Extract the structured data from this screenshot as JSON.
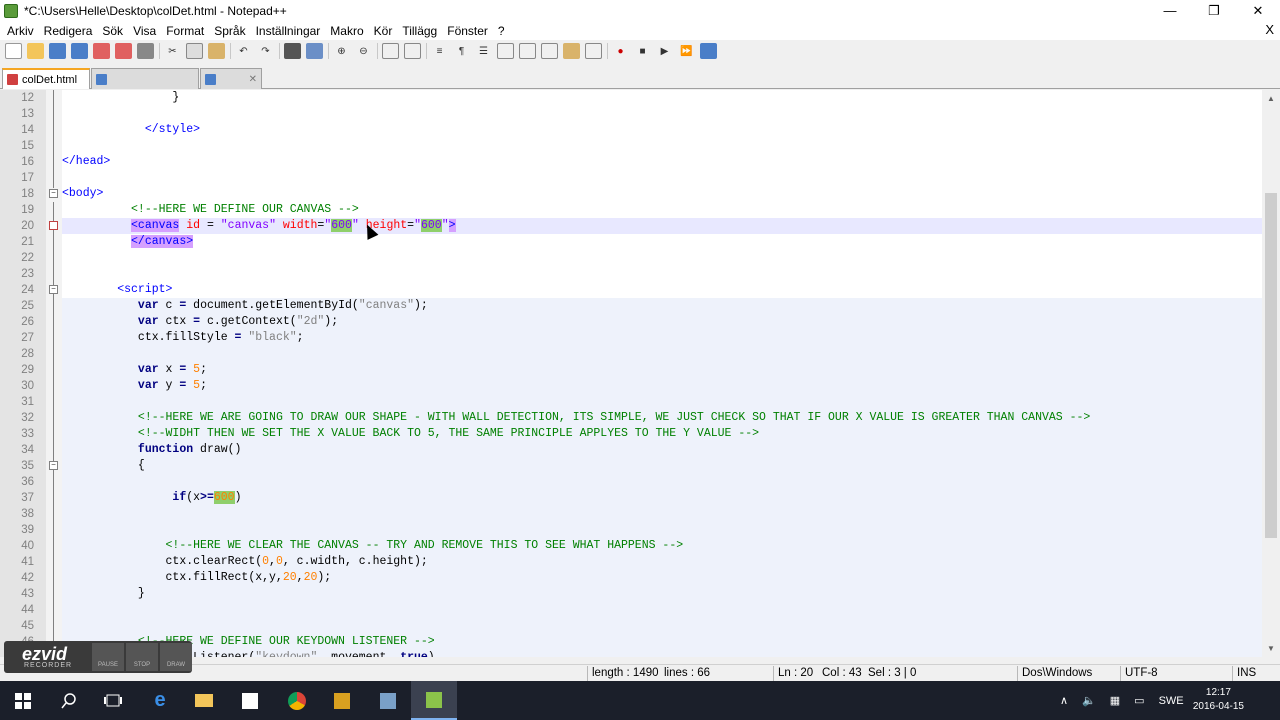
{
  "window": {
    "title": "*C:\\Users\\Helle\\Desktop\\colDet.html - Notepad++",
    "minimize": "—",
    "restore": "❐",
    "close": "✕"
  },
  "menu": {
    "items": [
      "Arkiv",
      "Redigera",
      "Sök",
      "Visa",
      "Format",
      "Språk",
      "Inställningar",
      "Makro",
      "Kör",
      "Tillägg",
      "Fönster",
      "?"
    ],
    "close_doc": "X"
  },
  "tabs": [
    {
      "label": "colDet.html",
      "active": true
    },
    {
      "label": "",
      "active": false
    },
    {
      "label": "",
      "active": false
    }
  ],
  "editor": {
    "lines": [
      {
        "n": "12",
        "tokens": [
          {
            "t": "                }",
            "c": "t-plain"
          }
        ]
      },
      {
        "n": "13",
        "tokens": []
      },
      {
        "n": "14",
        "tokens": [
          {
            "t": "            ",
            "c": "t-plain"
          },
          {
            "t": "</style>",
            "c": "t-tag"
          }
        ]
      },
      {
        "n": "15",
        "tokens": []
      },
      {
        "n": "16",
        "tokens": [
          {
            "t": "</head>",
            "c": "t-tag"
          }
        ]
      },
      {
        "n": "17",
        "tokens": []
      },
      {
        "n": "18",
        "tokens": [
          {
            "t": "<body>",
            "c": "t-tag"
          }
        ]
      },
      {
        "n": "19",
        "tokens": [
          {
            "t": "          ",
            "c": "t-plain"
          },
          {
            "t": "<!--HERE WE DEFINE OUR CANVAS -->",
            "c": "t-cmt"
          }
        ]
      },
      {
        "n": "20",
        "tokens": [
          {
            "t": "          ",
            "c": "t-plain"
          },
          {
            "t": "<canvas",
            "c": "t-tag hl-tag"
          },
          {
            "t": " ",
            "c": "t-plain"
          },
          {
            "t": "id",
            "c": "t-attr"
          },
          {
            "t": " = ",
            "c": "t-plain"
          },
          {
            "t": "\"canvas\"",
            "c": "t-val"
          },
          {
            "t": " ",
            "c": "t-plain"
          },
          {
            "t": "width",
            "c": "t-attr"
          },
          {
            "t": "=",
            "c": "t-plain"
          },
          {
            "t": "\"",
            "c": "t-val"
          },
          {
            "t": "600",
            "c": "t-val hl-green"
          },
          {
            "t": "\"",
            "c": "t-val"
          },
          {
            "t": " ",
            "c": "t-plain"
          },
          {
            "t": "height",
            "c": "t-attr"
          },
          {
            "t": "=",
            "c": "t-plain"
          },
          {
            "t": "\"",
            "c": "t-val"
          },
          {
            "t": "600",
            "c": "t-val hl-green"
          },
          {
            "t": "\"",
            "c": "t-val"
          },
          {
            "t": ">",
            "c": "t-tag hl-tag"
          }
        ]
      },
      {
        "n": "21",
        "tokens": [
          {
            "t": "          ",
            "c": "t-plain"
          },
          {
            "t": "</canvas>",
            "c": "t-tag hl-tag"
          }
        ]
      },
      {
        "n": "22",
        "tokens": []
      },
      {
        "n": "23",
        "tokens": []
      },
      {
        "n": "24",
        "tokens": [
          {
            "t": "        ",
            "c": "t-plain"
          },
          {
            "t": "<script>",
            "c": "t-tag"
          }
        ]
      },
      {
        "n": "25",
        "tokens": [
          {
            "t": "           ",
            "c": "t-plain"
          },
          {
            "t": "var",
            "c": "t-kw"
          },
          {
            "t": " c ",
            "c": "t-plain"
          },
          {
            "t": "=",
            "c": "t-op"
          },
          {
            "t": " document.getElementById(",
            "c": "t-plain"
          },
          {
            "t": "\"canvas\"",
            "c": "t-str"
          },
          {
            "t": ");",
            "c": "t-plain"
          }
        ]
      },
      {
        "n": "26",
        "tokens": [
          {
            "t": "           ",
            "c": "t-plain"
          },
          {
            "t": "var",
            "c": "t-kw"
          },
          {
            "t": " ctx ",
            "c": "t-plain"
          },
          {
            "t": "=",
            "c": "t-op"
          },
          {
            "t": " c.getContext(",
            "c": "t-plain"
          },
          {
            "t": "\"2d\"",
            "c": "t-str"
          },
          {
            "t": ");",
            "c": "t-plain"
          }
        ]
      },
      {
        "n": "27",
        "tokens": [
          {
            "t": "           ctx.fillStyle ",
            "c": "t-plain"
          },
          {
            "t": "=",
            "c": "t-op"
          },
          {
            "t": " ",
            "c": "t-plain"
          },
          {
            "t": "\"black\"",
            "c": "t-str"
          },
          {
            "t": ";",
            "c": "t-plain"
          }
        ]
      },
      {
        "n": "28",
        "tokens": []
      },
      {
        "n": "29",
        "tokens": [
          {
            "t": "           ",
            "c": "t-plain"
          },
          {
            "t": "var",
            "c": "t-kw"
          },
          {
            "t": " x ",
            "c": "t-plain"
          },
          {
            "t": "=",
            "c": "t-op"
          },
          {
            "t": " ",
            "c": "t-plain"
          },
          {
            "t": "5",
            "c": "t-num"
          },
          {
            "t": ";",
            "c": "t-plain"
          }
        ]
      },
      {
        "n": "30",
        "tokens": [
          {
            "t": "           ",
            "c": "t-plain"
          },
          {
            "t": "var",
            "c": "t-kw"
          },
          {
            "t": " y ",
            "c": "t-plain"
          },
          {
            "t": "=",
            "c": "t-op"
          },
          {
            "t": " ",
            "c": "t-plain"
          },
          {
            "t": "5",
            "c": "t-num"
          },
          {
            "t": ";",
            "c": "t-plain"
          }
        ]
      },
      {
        "n": "31",
        "tokens": []
      },
      {
        "n": "32",
        "tokens": [
          {
            "t": "           ",
            "c": "t-plain"
          },
          {
            "t": "<!--HERE WE ARE GOING TO DRAW OUR SHAPE - WITH WALL DETECTION, ITS SIMPLE, WE JUST CHECK SO THAT IF OUR X VALUE IS GREATER THAN CANVAS -->",
            "c": "t-cmt"
          }
        ]
      },
      {
        "n": "33",
        "tokens": [
          {
            "t": "           ",
            "c": "t-plain"
          },
          {
            "t": "<!--WIDHT THEN WE SET THE X VALUE BACK TO 5, THE SAME PRINCIPLE APPLYES TO THE Y VALUE -->",
            "c": "t-cmt"
          }
        ]
      },
      {
        "n": "34",
        "tokens": [
          {
            "t": "           ",
            "c": "t-plain"
          },
          {
            "t": "function",
            "c": "t-kw"
          },
          {
            "t": " draw()",
            "c": "t-plain"
          }
        ]
      },
      {
        "n": "35",
        "tokens": [
          {
            "t": "           {",
            "c": "t-plain"
          }
        ]
      },
      {
        "n": "36",
        "tokens": []
      },
      {
        "n": "37",
        "tokens": [
          {
            "t": "                ",
            "c": "t-plain"
          },
          {
            "t": "if",
            "c": "t-kw"
          },
          {
            "t": "(x",
            "c": "t-plain"
          },
          {
            "t": ">=",
            "c": "t-op"
          },
          {
            "t": "600",
            "c": "t-num hl-green"
          },
          {
            "t": ")",
            "c": "t-plain"
          }
        ]
      },
      {
        "n": "38",
        "tokens": []
      },
      {
        "n": "39",
        "tokens": []
      },
      {
        "n": "40",
        "tokens": [
          {
            "t": "               ",
            "c": "t-plain"
          },
          {
            "t": "<!--HERE WE CLEAR THE CANVAS -- TRY AND REMOVE THIS TO SEE WHAT HAPPENS -->",
            "c": "t-cmt"
          }
        ]
      },
      {
        "n": "41",
        "tokens": [
          {
            "t": "               ctx.clearRect(",
            "c": "t-plain"
          },
          {
            "t": "0",
            "c": "t-num"
          },
          {
            "t": ",",
            "c": "t-plain"
          },
          {
            "t": "0",
            "c": "t-num"
          },
          {
            "t": ", c.width, c.height);",
            "c": "t-plain"
          }
        ]
      },
      {
        "n": "42",
        "tokens": [
          {
            "t": "               ctx.fillRect(x,y,",
            "c": "t-plain"
          },
          {
            "t": "20",
            "c": "t-num"
          },
          {
            "t": ",",
            "c": "t-plain"
          },
          {
            "t": "20",
            "c": "t-num"
          },
          {
            "t": ");",
            "c": "t-plain"
          }
        ]
      },
      {
        "n": "43",
        "tokens": [
          {
            "t": "           }",
            "c": "t-plain"
          }
        ]
      },
      {
        "n": "44",
        "tokens": []
      },
      {
        "n": "45",
        "tokens": []
      },
      {
        "n": "46",
        "tokens": [
          {
            "t": "           ",
            "c": "t-plain"
          },
          {
            "t": "<!--HERE WE DEFINE OUR KEYDOWN LISTENER -->",
            "c": "t-cmt"
          }
        ]
      },
      {
        "n": "47",
        "tokens": [
          {
            "t": "           addEventListener(",
            "c": "t-plain"
          },
          {
            "t": "\"keydown\"",
            "c": "t-str"
          },
          {
            "t": ", movement, ",
            "c": "t-plain"
          },
          {
            "t": "true",
            "c": "t-kw"
          },
          {
            "t": ")",
            "c": "t-plain"
          }
        ]
      }
    ]
  },
  "status": {
    "filetype": "",
    "length": "length : 1490",
    "lines": "lines : 66",
    "ln": "Ln : 20",
    "col": "Col : 43",
    "sel": "Sel : 3 | 0",
    "eol": "Dos\\Windows",
    "encoding": "UTF-8",
    "mode": "INS"
  },
  "ezvid": {
    "logo": "ezvid",
    "sub": "RECORDER",
    "buttons": [
      "PAUSE",
      "STOP",
      "DRAW"
    ]
  },
  "taskbar": {
    "lang": "SWE",
    "time": "12:17",
    "date": "2016-04-15"
  }
}
